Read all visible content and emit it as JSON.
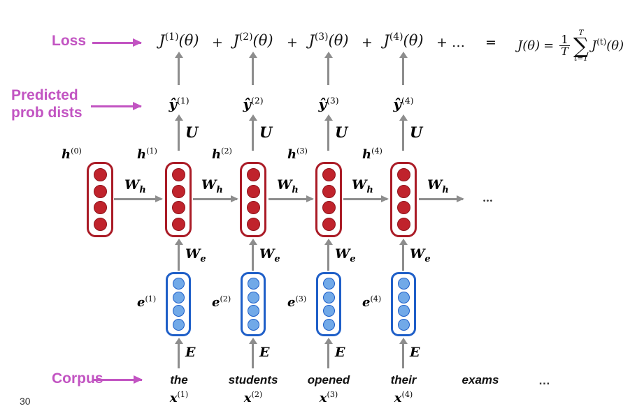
{
  "slide": {
    "page_number": "30",
    "colors": {
      "label_magenta": "#c254c2",
      "hidden_border_red": "#aa1b26",
      "hidden_node_red": "#c0232c",
      "embed_border_blue": "#1f5fc8",
      "embed_node_blue": "#71a9e8",
      "arrow_gray": "#8d8d8d"
    }
  },
  "labels": {
    "loss": "Loss",
    "predicted": "Predicted\nprob dists",
    "corpus": "Corpus"
  },
  "loss_row": {
    "terms": [
      {
        "symbol": "J",
        "superscript": "(1)",
        "arg": "(θ)"
      },
      {
        "symbol": "J",
        "superscript": "(2)",
        "arg": "(θ)"
      },
      {
        "symbol": "J",
        "superscript": "(3)",
        "arg": "(θ)"
      },
      {
        "symbol": "J",
        "superscript": "(4)",
        "arg": "(θ)"
      }
    ],
    "plus": "+",
    "plus_ellipsis": "+ …",
    "equals": "=",
    "total_formula": {
      "lhs": "J(θ)",
      "equals": "=",
      "fraction_numerator": "1",
      "fraction_denominator": "T",
      "sum_upper": "T",
      "sum_lower": "t=1",
      "sum_symbol": "∑",
      "term": "J",
      "term_superscript": "(t)",
      "term_arg": "(θ)"
    }
  },
  "output_row": {
    "items": [
      {
        "symbol": "ŷ",
        "superscript": "(1)"
      },
      {
        "symbol": "ŷ",
        "superscript": "(2)"
      },
      {
        "symbol": "ŷ",
        "superscript": "(3)"
      },
      {
        "symbol": "ŷ",
        "superscript": "(4)"
      }
    ],
    "weight_label": "U"
  },
  "hidden_row": {
    "items": [
      {
        "symbol": "h",
        "superscript": "(0)"
      },
      {
        "symbol": "h",
        "superscript": "(1)"
      },
      {
        "symbol": "h",
        "superscript": "(2)"
      },
      {
        "symbol": "h",
        "superscript": "(3)"
      },
      {
        "symbol": "h",
        "superscript": "(4)"
      }
    ],
    "recurrent_weight": "W",
    "recurrent_weight_sub": "h",
    "nodes_per_stack": 4,
    "trailing_ellipsis": "…"
  },
  "embedding_row": {
    "items": [
      {
        "symbol": "e",
        "superscript": "(1)"
      },
      {
        "symbol": "e",
        "superscript": "(2)"
      },
      {
        "symbol": "e",
        "superscript": "(3)"
      },
      {
        "symbol": "e",
        "superscript": "(4)"
      }
    ],
    "weight": "W",
    "weight_sub": "e",
    "embed_matrix": "E",
    "nodes_per_stack": 4
  },
  "corpus_row": {
    "words": [
      {
        "word": "the",
        "symbol": "x",
        "superscript": "(1)"
      },
      {
        "word": "students",
        "symbol": "x",
        "superscript": "(2)"
      },
      {
        "word": "opened",
        "symbol": "x",
        "superscript": "(3)"
      },
      {
        "word": "their",
        "symbol": "x",
        "superscript": "(4)"
      },
      {
        "word": "exams",
        "symbol": "",
        "superscript": ""
      }
    ],
    "trailing_ellipsis": "…"
  }
}
